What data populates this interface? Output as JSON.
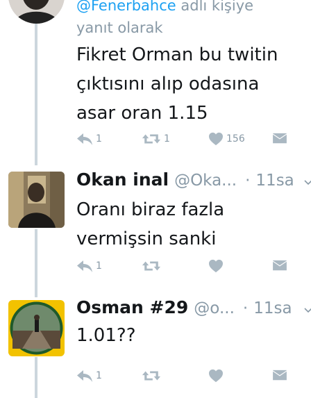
{
  "tweet1": {
    "reply_prefix_mention": "@Fenerbahce",
    "reply_prefix_rest": " adlı kişiye",
    "reply_line2": "yanıt olarak",
    "text_lines": [
      "Fikret Orman bu twitin",
      "çıktısını alıp odasına",
      "asar oran 1.15"
    ],
    "reply_count": "1",
    "retweet_count": "1",
    "like_count": "156"
  },
  "tweet2": {
    "name": "Okan inal",
    "handle": "@Oka...",
    "dot": "·",
    "time": "11sa",
    "text_lines": [
      "Oranı biraz fazla",
      "vermişsin sanki"
    ],
    "reply_count": "1"
  },
  "tweet3": {
    "name": "Osman #29",
    "handle": "@o...",
    "dot": "·",
    "time": "11sa",
    "text_lines": [
      "1.01??"
    ],
    "reply_count": "1"
  },
  "icons": [
    "reply-icon",
    "retweet-icon",
    "like-icon",
    "direct-message-icon",
    "chevron-down-icon"
  ],
  "colors": {
    "text": "#14171a",
    "muted": "#8899a6",
    "link": "#1da1f2",
    "thread_line": "#ccd6dd",
    "icon": "#aab8c2"
  }
}
